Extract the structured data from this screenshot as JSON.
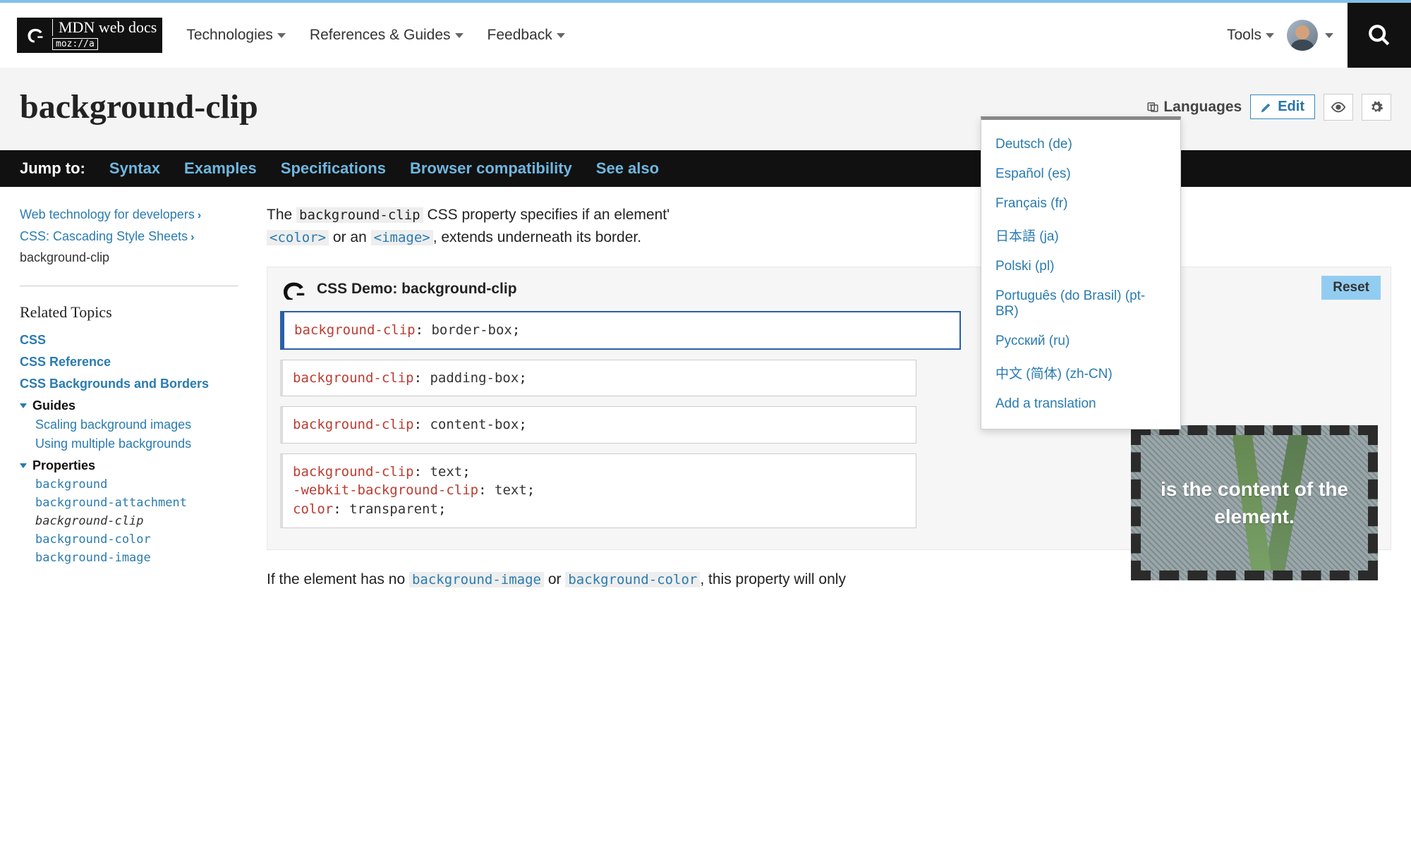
{
  "nav": {
    "brand_top": "MDN web docs",
    "brand_sub": "moz://a",
    "items": [
      "Technologies",
      "References & Guides",
      "Feedback"
    ],
    "tools": "Tools"
  },
  "title": "background-clip",
  "titlebar": {
    "languages": "Languages",
    "edit": "Edit"
  },
  "languages_menu": [
    "Deutsch (de)",
    "Español (es)",
    "Français (fr)",
    "日本語 (ja)",
    "Polski (pl)",
    "Português (do Brasil) (pt-BR)",
    "Русский (ru)",
    "中文 (简体) (zh-CN)",
    "Add a translation"
  ],
  "jump": {
    "label": "Jump to:",
    "links": [
      "Syntax",
      "Examples",
      "Specifications",
      "Browser compatibility",
      "See also"
    ]
  },
  "breadcrumbs": [
    "Web technology for developers",
    "CSS: Cascading Style Sheets"
  ],
  "breadcrumb_current": "background-clip",
  "sidebar": {
    "heading": "Related Topics",
    "links": [
      "CSS",
      "CSS Reference",
      "CSS Backgrounds and Borders"
    ],
    "guides_label": "Guides",
    "guides": [
      "Scaling background images",
      "Using multiple backgrounds"
    ],
    "props_label": "Properties",
    "props": [
      "background",
      "background-attachment",
      "background-clip",
      "background-color",
      "background-image"
    ],
    "current_prop": "background-clip"
  },
  "intro": {
    "t1": "The ",
    "code1": "background-clip",
    "t2": " CSS property specifies if an element'",
    "code2": "<color>",
    "t3": " or an ",
    "code3": "<image>",
    "t4": ", extends underneath its border."
  },
  "demo": {
    "title": "CSS Demo: background-clip",
    "reset": "Reset",
    "snippets": [
      [
        [
          "background-clip",
          ": ",
          "border-box",
          ";"
        ]
      ],
      [
        [
          "background-clip",
          ": ",
          "padding-box",
          ";"
        ]
      ],
      [
        [
          "background-clip",
          ": ",
          "content-box",
          ";"
        ]
      ],
      [
        [
          "background-clip",
          ": ",
          "text",
          ";"
        ],
        [
          "-webkit-background-clip",
          ": ",
          "text",
          ";"
        ],
        [
          "color",
          ": ",
          "transparent",
          ";"
        ]
      ]
    ],
    "preview_text": "is the content of the element."
  },
  "below": {
    "t1": "If the element has no ",
    "code1": "background-image",
    "t2": " or ",
    "code2": "background-color",
    "t3": ", this property will only"
  }
}
